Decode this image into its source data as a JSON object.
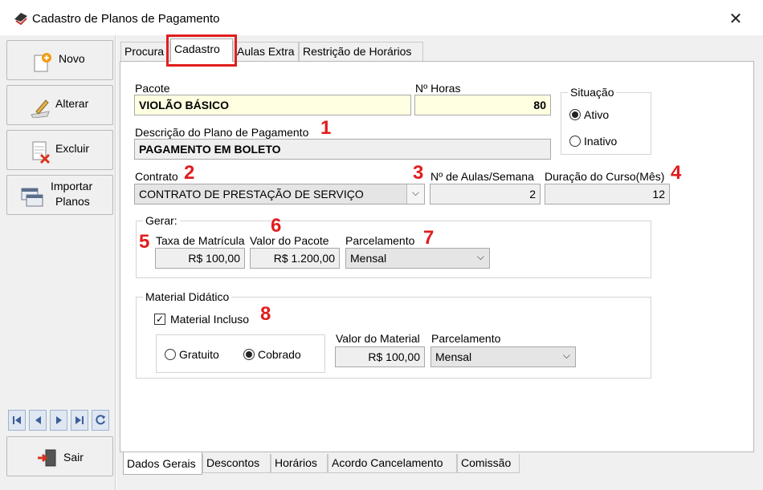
{
  "window": {
    "title": "Cadastro de Planos de Pagamento",
    "close_glyph": "✕"
  },
  "sidebar": {
    "buttons": [
      {
        "label": "Novo",
        "icon": "new-document-icon"
      },
      {
        "label": "Alterar",
        "icon": "edit-pencil-icon"
      },
      {
        "label": "Excluir",
        "icon": "delete-document-icon"
      },
      {
        "label": "Importar Planos",
        "label_line1": "Importar",
        "label_line2": "Planos",
        "icon": "import-windows-icon"
      },
      {
        "label": "Sair",
        "icon": "exit-door-icon"
      }
    ],
    "navigator": [
      "first-record-icon",
      "prior-record-icon",
      "next-record-icon",
      "last-record-icon",
      "refresh-icon"
    ]
  },
  "tabs_top": [
    "Procura",
    "Cadastro",
    "Aulas Extra",
    "Restrição de Horários"
  ],
  "active_top_tab": "Cadastro",
  "form": {
    "pacote": {
      "label": "Pacote",
      "value": "VIOLÃO BÁSICO"
    },
    "horas": {
      "label": "Nº Horas",
      "value": "80"
    },
    "situacao": {
      "label": "Situação",
      "options": [
        "Ativo",
        "Inativo"
      ],
      "selected": "Ativo"
    },
    "descricao": {
      "label": "Descrição do Plano de Pagamento",
      "value": "PAGAMENTO EM BOLETO"
    },
    "contrato": {
      "label": "Contrato",
      "value": "CONTRATO DE PRESTAÇÃO DE SERVIÇO"
    },
    "aulas_semana": {
      "label": "Nº de Aulas/Semana",
      "value": "2"
    },
    "duracao": {
      "label": "Duração do Curso(Mês)",
      "value": "12"
    },
    "gerar": {
      "title": "Gerar:",
      "taxa": {
        "label": "Taxa de Matrícula",
        "value": "R$ 100,00"
      },
      "valor_pacote": {
        "label": "Valor do Pacote",
        "value": "R$ 1.200,00"
      },
      "parcelamento": {
        "label": "Parcelamento",
        "value": "Mensal"
      }
    },
    "material": {
      "title": "Material Didático",
      "incluso": {
        "label": "Material Incluso",
        "checked": true
      },
      "options": [
        "Gratuito",
        "Cobrado"
      ],
      "selected": "Cobrado",
      "valor": {
        "label": "Valor do Material",
        "value": "R$ 100,00"
      },
      "parcelamento": {
        "label": "Parcelamento",
        "value": "Mensal"
      }
    }
  },
  "annotations": [
    "1",
    "2",
    "3",
    "4",
    "5",
    "6",
    "7",
    "8"
  ],
  "annotation_color": "#e11d1d",
  "tabs_bottom": [
    "Dados Gerais",
    "Descontos",
    "Horários",
    "Acordo Cancelamento",
    "Comissão"
  ],
  "active_bottom_tab": "Dados Gerais",
  "colors": {
    "yellow_field": "#ffffe1",
    "gray_field": "#efefef",
    "highlight_box": "#e11d1d"
  }
}
